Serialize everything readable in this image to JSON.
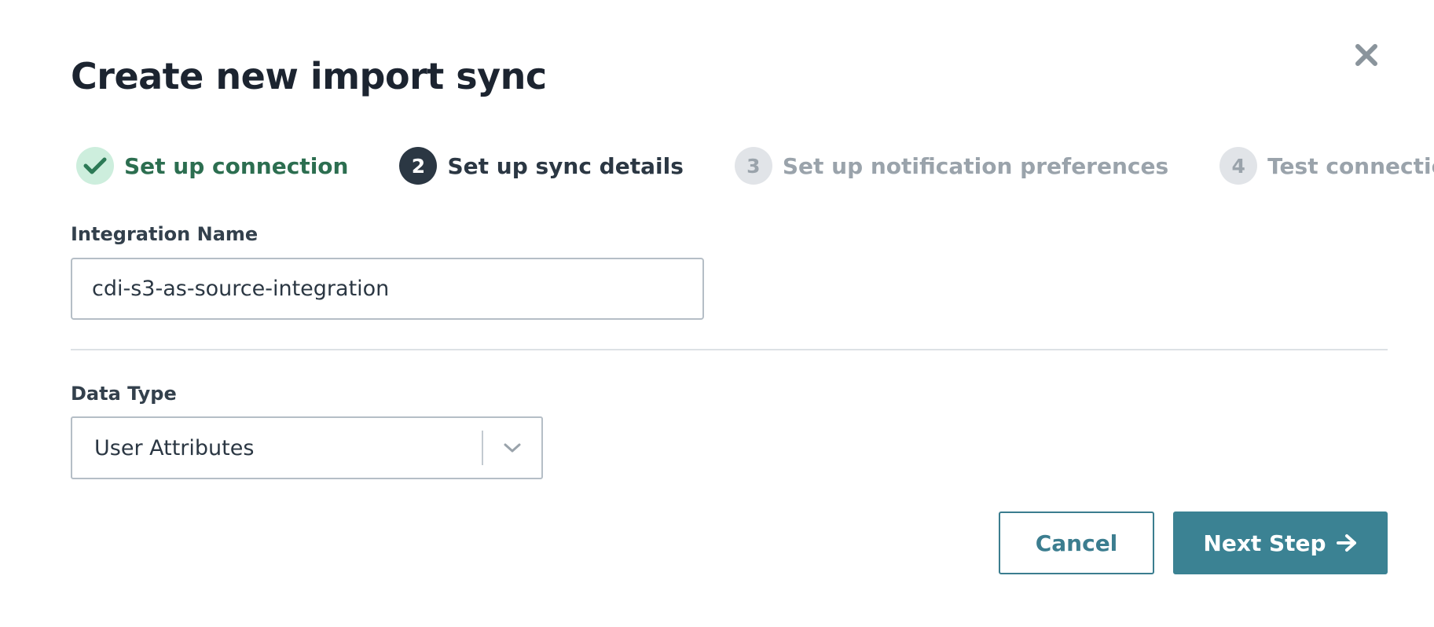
{
  "modal": {
    "title": "Create new import sync",
    "close_icon": "close-icon"
  },
  "steps": [
    {
      "status": "done",
      "badge": "",
      "icon": "check-icon",
      "label": "Set up connection"
    },
    {
      "status": "active",
      "badge": "2",
      "label": "Set up sync details"
    },
    {
      "status": "pending",
      "badge": "3",
      "label": "Set up notification preferences"
    },
    {
      "status": "pending",
      "badge": "4",
      "label": "Test connection"
    }
  ],
  "form": {
    "integration_name": {
      "label": "Integration Name",
      "value": "cdi-s3-as-source-integration"
    },
    "data_type": {
      "label": "Data Type",
      "selected": "User Attributes",
      "icon": "chevron-down-icon"
    }
  },
  "actions": {
    "cancel_label": "Cancel",
    "next_label": "Next Step",
    "next_icon": "arrow-right-icon"
  },
  "colors": {
    "primary": "#3b8293",
    "success": "#2c6e50",
    "success_bg": "#cdeedd",
    "active_step": "#2b3743",
    "muted": "#9aa3ab"
  }
}
